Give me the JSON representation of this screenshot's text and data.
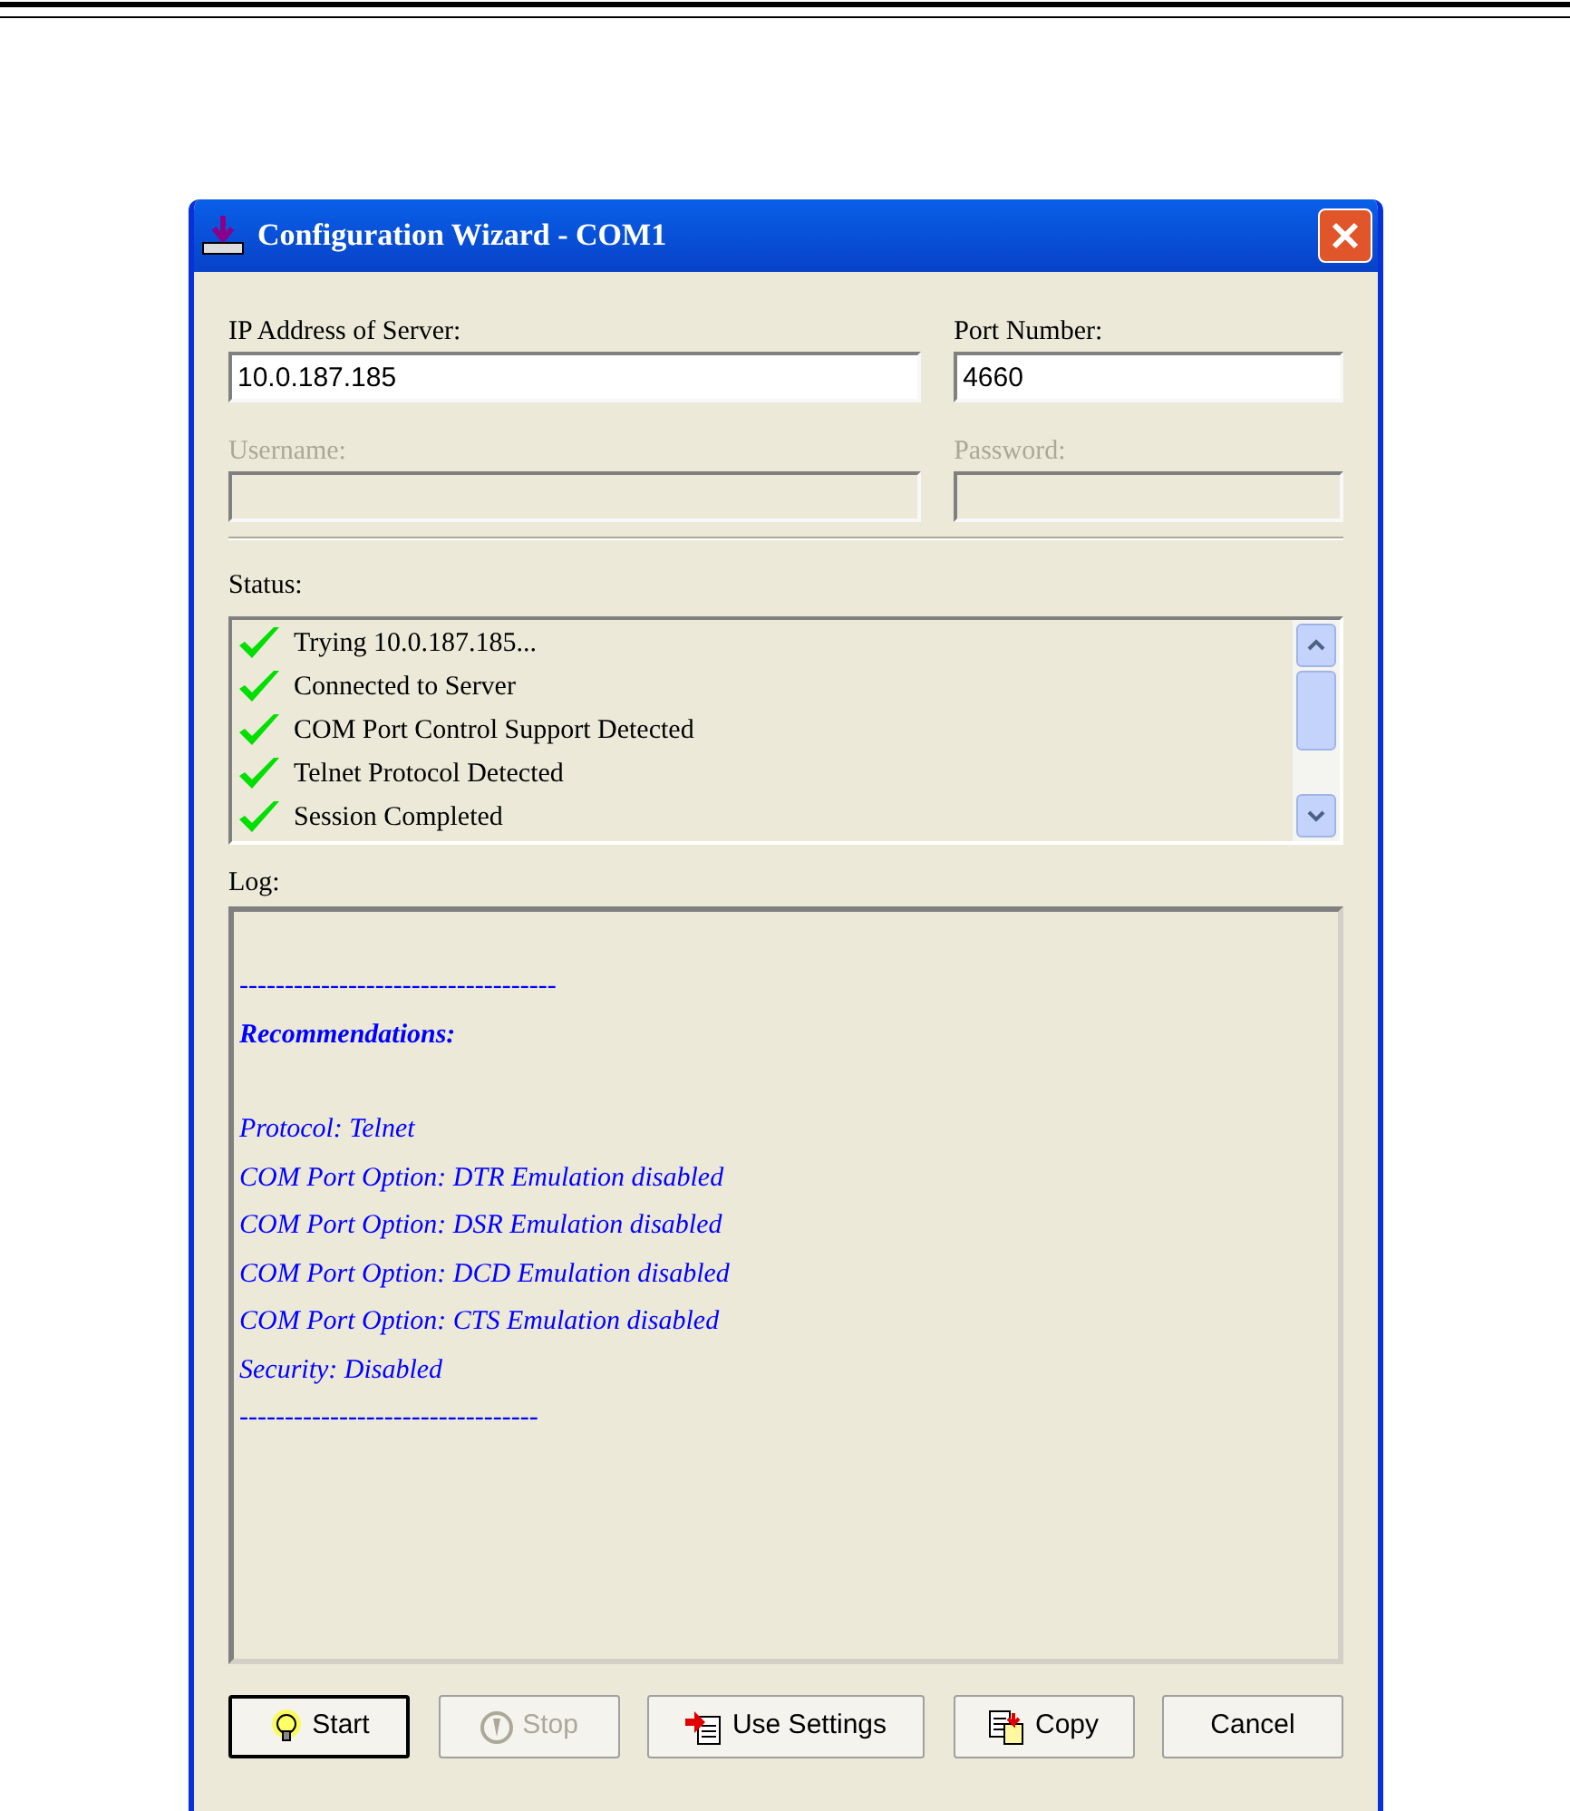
{
  "window": {
    "title": "Configuration Wizard - COM1"
  },
  "fields": [
    {
      "label": "IP Address of Server:",
      "value": "10.0.187.185",
      "disabled": false
    },
    {
      "label": "Port Number:",
      "value": "4660",
      "disabled": false
    },
    {
      "label": "Username:",
      "disabled": true
    },
    {
      "label": "Password:",
      "disabled": true
    }
  ],
  "status": {
    "label": "Status:",
    "items": [
      {
        "text": "Trying 10.0.187.185...",
        "checked": true
      },
      {
        "text": "Connected to Server",
        "checked": true
      },
      {
        "text": "COM Port Control Support Detected",
        "checked": true
      },
      {
        "text": "Telnet Protocol Detected",
        "checked": true
      },
      {
        "text": "Session Completed",
        "checked": true
      }
    ]
  },
  "log": {
    "label": "Log:",
    "lines": [
      {
        "kind": "rule",
        "text": "-----------------------------------"
      },
      {
        "kind": "heading",
        "text": "Recommendations:"
      },
      {
        "kind": "text",
        "text": "Protocol: Telnet"
      },
      {
        "kind": "text",
        "text": "COM Port Option: DTR Emulation disabled"
      },
      {
        "kind": "text",
        "text": "COM Port Option: DSR Emulation disabled"
      },
      {
        "kind": "text",
        "text": "COM Port Option: DCD Emulation disabled"
      },
      {
        "kind": "text",
        "text": "COM Port Option: CTS Emulation disabled"
      },
      {
        "kind": "text",
        "text": "Security: Disabled"
      },
      {
        "kind": "rule",
        "text": "---------------------------------"
      }
    ]
  },
  "buttons": [
    {
      "label": "Start",
      "kind": "start",
      "disabled": false,
      "default": true
    },
    {
      "label": "Stop",
      "kind": "stop",
      "disabled": true,
      "default": false
    },
    {
      "label": "Use Settings",
      "kind": "use",
      "disabled": false,
      "default": false
    },
    {
      "label": "Copy",
      "kind": "copy",
      "disabled": false,
      "default": false
    },
    {
      "label": "Cancel",
      "kind": "plain",
      "disabled": false,
      "default": false
    }
  ]
}
